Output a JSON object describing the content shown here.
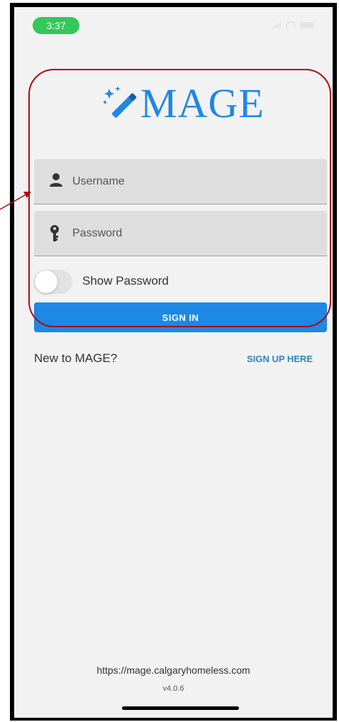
{
  "status_bar": {
    "time": "3:37"
  },
  "app": {
    "logo_text": "MAGE"
  },
  "login_form": {
    "username_placeholder": "Username",
    "password_placeholder": "Password",
    "show_password_label": "Show Password",
    "show_password_on": false,
    "signin_label": "SIGN IN"
  },
  "signup": {
    "prompt": "New to MAGE?",
    "link_label": "SIGN UP HERE"
  },
  "footer": {
    "server_url": "https://mage.calgaryhomeless.com",
    "version": "v4.0.6"
  },
  "colors": {
    "accent": "#1e88e5",
    "annotation": "#b00a10",
    "status_pill": "#34c759"
  },
  "icons": [
    "magic-wand-icon",
    "user-icon",
    "key-icon",
    "signal-icon",
    "wifi-icon",
    "battery-icon"
  ]
}
